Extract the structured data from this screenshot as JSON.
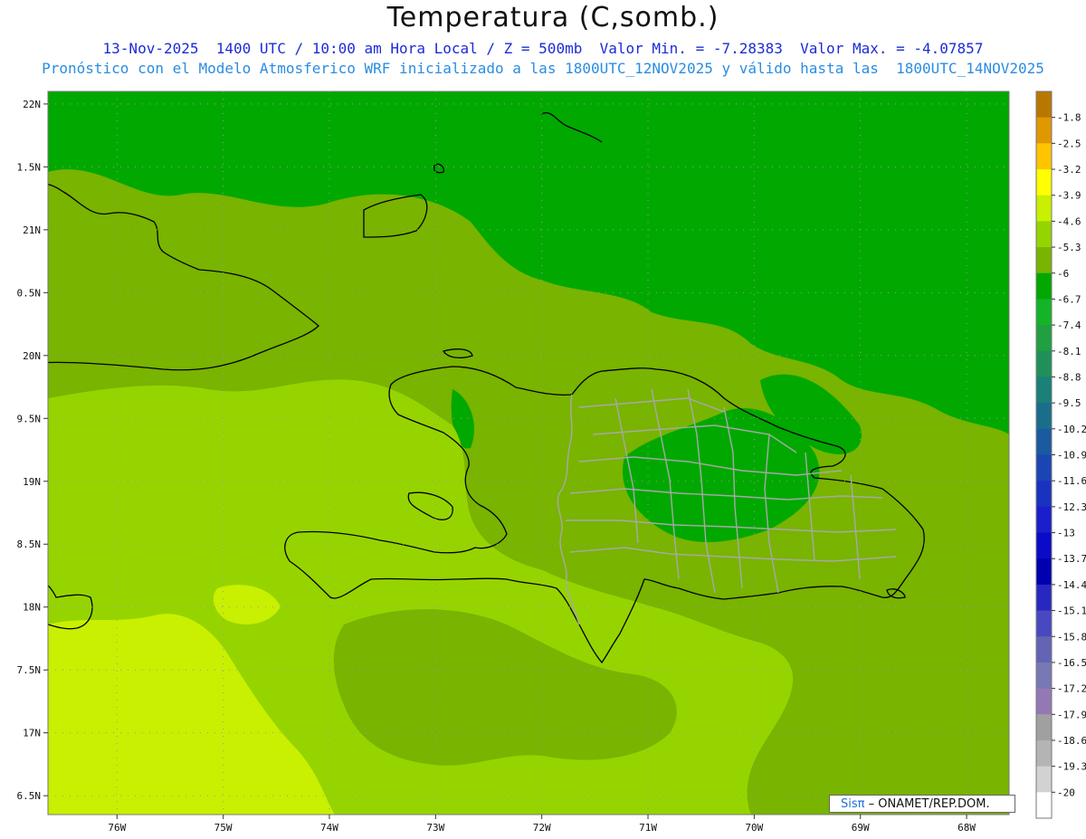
{
  "title": "Temperatura (C,somb.)",
  "subtitle_line1": "13-Nov-2025  1400 UTC / 10:00 am Hora Local / Z = 500mb  Valor Min. = -7.28383  Valor Max. = -4.07857",
  "subtitle_line2": "Pronóstico con el Modelo Atmosferico WRF inicializado a las 1800UTC_12NOV2025 y válido hasta las  1800UTC_14NOV2025",
  "credit": {
    "brand": "Sisπ",
    "text": " – ONAMET/REP.DOM."
  },
  "map": {
    "lon_range": [
      -76.65,
      -67.6
    ],
    "lat_range": [
      16.35,
      22.1
    ],
    "lon_ticks": [
      {
        "value": -76,
        "label": "76W"
      },
      {
        "value": -75,
        "label": "75W"
      },
      {
        "value": -74,
        "label": "74W"
      },
      {
        "value": -73,
        "label": "73W"
      },
      {
        "value": -72,
        "label": "72W"
      },
      {
        "value": -71,
        "label": "71W"
      },
      {
        "value": -70,
        "label": "70W"
      },
      {
        "value": -69,
        "label": "69W"
      },
      {
        "value": -68,
        "label": "68W"
      }
    ],
    "lat_ticks": [
      {
        "value": 22,
        "label": "22N"
      },
      {
        "value": 21.5,
        "label": "1.5N"
      },
      {
        "value": 21,
        "label": "21N"
      },
      {
        "value": 20.5,
        "label": "0.5N"
      },
      {
        "value": 20,
        "label": "20N"
      },
      {
        "value": 19.5,
        "label": "9.5N"
      },
      {
        "value": 19,
        "label": "19N"
      },
      {
        "value": 18.5,
        "label": "8.5N"
      },
      {
        "value": 18,
        "label": "18N"
      },
      {
        "value": 17.5,
        "label": "7.5N"
      },
      {
        "value": 17,
        "label": "17N"
      },
      {
        "value": 16.5,
        "label": "6.5N"
      }
    ]
  },
  "colorbar": {
    "labels": [
      "-1.8",
      "-2.5",
      "-3.2",
      "-3.9",
      "-4.6",
      "-5.3",
      "-6",
      "-6.7",
      "-7.4",
      "-8.1",
      "-8.8",
      "-9.5",
      "-10.2",
      "-10.9",
      "-11.6",
      "-12.3",
      "-13",
      "-13.7",
      "-14.4",
      "-15.1",
      "-15.8",
      "-16.5",
      "-17.2",
      "-17.9",
      "-18.6",
      "-19.3",
      "-20"
    ],
    "colors": [
      "#b87800",
      "#e09800",
      "#ffc400",
      "#ffff00",
      "#c8f000",
      "#96d400",
      "#78b400",
      "#00a800",
      "#14b428",
      "#20a040",
      "#20905a",
      "#1a8078",
      "#1a6e8c",
      "#1a5aa0",
      "#1a46b4",
      "#1a32c0",
      "#1a1ecc",
      "#0a0ac8",
      "#0000b0",
      "#2828c0",
      "#4848c0",
      "#6464b4",
      "#7878b4",
      "#9478b4",
      "#a0a0a0",
      "#b4b4b4",
      "#d2d2d2",
      "#ffffff"
    ]
  }
}
